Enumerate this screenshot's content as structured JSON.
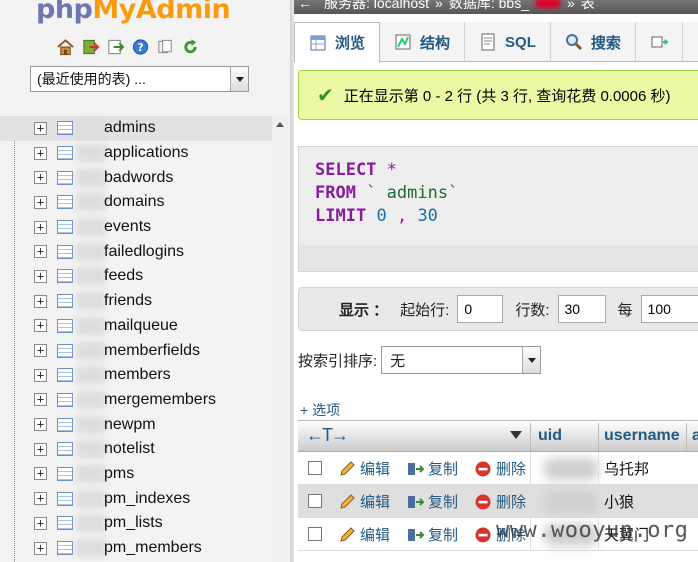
{
  "logo": {
    "part1": "php",
    "part2": "MyAdmin"
  },
  "nav_icons": [
    "home-icon",
    "exit-icon",
    "sql-query-icon",
    "help-icon",
    "docs-icon",
    "reload-icon"
  ],
  "recent_tables": {
    "selected": "(最近使用的表) ..."
  },
  "tables": [
    "admins",
    "applications",
    "badwords",
    "domains",
    "events",
    "failedlogins",
    "feeds",
    "friends",
    "mailqueue",
    "memberfields",
    "members",
    "mergemembers",
    "newpm",
    "notelist",
    "pms",
    "pm_indexes",
    "pm_lists",
    "pm_members"
  ],
  "highlighted_table": "admins",
  "breadcrumb": {
    "server_label": "服务器: localhost",
    "sep1": "»",
    "db_label": "数据库: bbs_",
    "sep2": "»",
    "table_label": "表"
  },
  "tabs": [
    {
      "label": "浏览",
      "icon": "browse-icon",
      "active": true
    },
    {
      "label": "结构",
      "icon": "structure-icon",
      "active": false
    },
    {
      "label": "SQL",
      "icon": "sql-icon",
      "active": false
    },
    {
      "label": "搜索",
      "icon": "search-icon",
      "active": false
    }
  ],
  "success_message": "正在显示第 0 - 2 行 (共 3 行, 查询花费 0.0006 秒)",
  "sql": {
    "select": "SELECT",
    "star": "*",
    "from": "FROM",
    "table": "`    admins`",
    "limit": "LIMIT",
    "offset": "0",
    "comma": ",",
    "count": "30"
  },
  "navigation": {
    "show_label": "显示 ：",
    "start_label": "起始行:",
    "start_value": "0",
    "rows_label": "行数:",
    "rows_value": "30",
    "per_label": "每",
    "per_value": "100"
  },
  "sort": {
    "label": "按索引排序:",
    "value": "无"
  },
  "options_link": "+ 选项",
  "columns": {
    "uid": "uid",
    "username": "username",
    "extra": "a"
  },
  "actions": {
    "edit": "编辑",
    "copy": "复制",
    "delete": "删除"
  },
  "rows": [
    {
      "username": "乌托邦"
    },
    {
      "username": "小狼"
    },
    {
      "username": "天翼门"
    }
  ],
  "watermark": "www.wooyun.org",
  "colors": {
    "link": "#235a81",
    "success_bg": "#ebf8a4",
    "keyword": "#8b1b9e"
  }
}
